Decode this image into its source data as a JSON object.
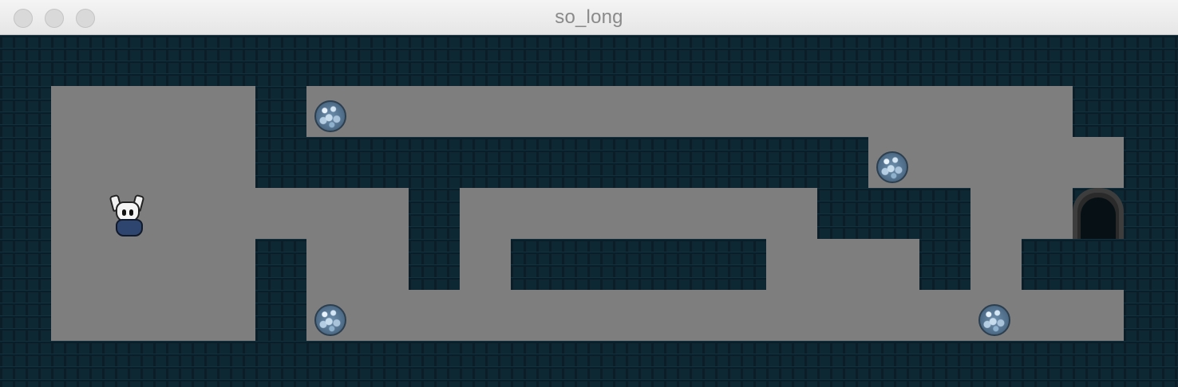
{
  "window": {
    "title": "so_long",
    "controls": [
      "close",
      "minimize",
      "zoom"
    ]
  },
  "game": {
    "floor_color": "#7e7e7e",
    "wall_color": "#0d2733",
    "player": "knight-sprite",
    "collectibles": 4,
    "exit": "arched-door"
  }
}
